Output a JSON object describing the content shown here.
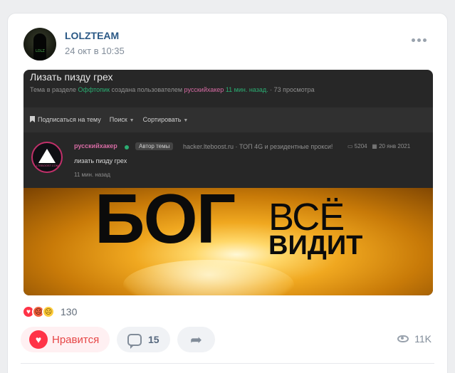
{
  "post": {
    "author": "LOLZTEAM",
    "date": "24 окт в 10:35",
    "avatar_text": "LOLZ"
  },
  "media": {
    "forum_title": "Лизать пизду грех",
    "meta_prefix": "Тема в разделе",
    "meta_section": "Оффтопик",
    "meta_created": "создана пользователем",
    "meta_user": "русскийхакер",
    "meta_time": "11 мин. назад.",
    "meta_views": "· 73 просмотра",
    "toolbar": {
      "subscribe": "Подписаться на тему",
      "search": "Поиск",
      "sort": "Сортировать"
    },
    "forum_post": {
      "user": "русскийхакер",
      "badge": "Автор темы",
      "ad": "hacker.lteboost.ru · ТОП 4G и резидентные прокси!",
      "views_count": "5204",
      "reg_date": "20 янв 2021",
      "text": "лизать пизду грех",
      "time": "11 мин. назад",
      "logo_text": "LTEBOOST.COM"
    },
    "banner": {
      "big_word": "БОГ",
      "word_top": "ВСЁ",
      "word_bottom": "ВИДИТ"
    }
  },
  "reactions": {
    "count": "130",
    "icons": [
      "heart-reaction",
      "angry-reaction",
      "sad-reaction"
    ]
  },
  "actions": {
    "like_label": "Нравится",
    "comments_count": "15",
    "views": "11K"
  },
  "colors": {
    "accent_like": "#ff3347",
    "author_link": "#2a5885",
    "forum_green": "#2bad72",
    "forum_pink": "#d66ba3"
  }
}
